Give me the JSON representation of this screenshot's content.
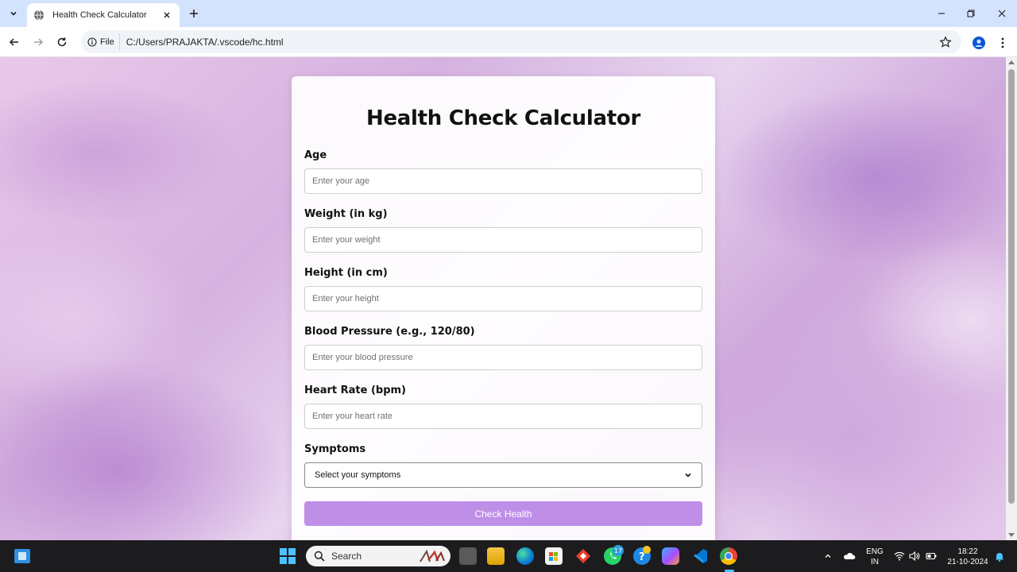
{
  "browser": {
    "tab_title": "Health Check Calculator",
    "address_chip": "File",
    "url": "C:/Users/PRAJAKTA/.vscode/hc.html"
  },
  "page": {
    "title": "Health Check Calculator",
    "fields": [
      {
        "label": "Age",
        "placeholder": "Enter your age"
      },
      {
        "label": "Weight (in kg)",
        "placeholder": "Enter your weight"
      },
      {
        "label": "Height (in cm)",
        "placeholder": "Enter your height"
      },
      {
        "label": "Blood Pressure (e.g., 120/80)",
        "placeholder": "Enter your blood pressure"
      },
      {
        "label": "Heart Rate (bpm)",
        "placeholder": "Enter your heart rate"
      }
    ],
    "symptoms": {
      "label": "Symptoms",
      "selected": "Select your symptoms"
    },
    "button": "Check Health",
    "colors": {
      "button": "#bf8fe8",
      "background_accent": "#d5b2e0"
    }
  },
  "taskbar": {
    "search_label": "Search",
    "whatsapp_badge": "17",
    "language_line1": "ENG",
    "language_line2": "IN",
    "time": "18:22",
    "date": "21-10-2024"
  }
}
